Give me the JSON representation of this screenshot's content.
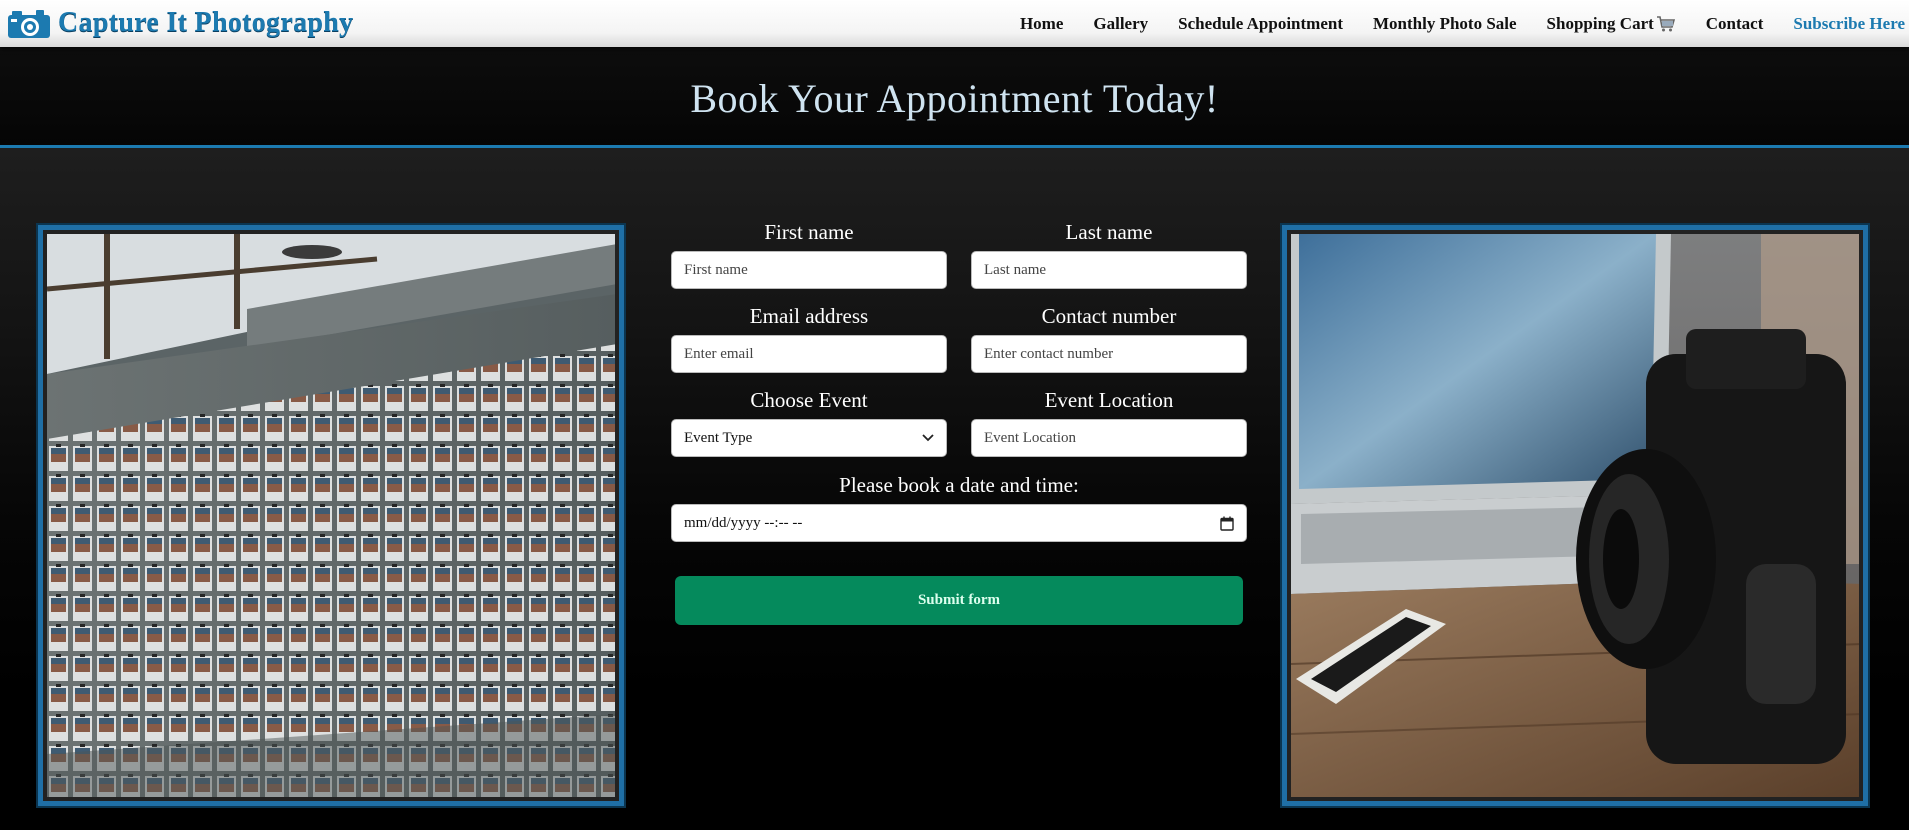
{
  "brand": {
    "name": "Capture It Photography",
    "icon": "camera-icon",
    "color": "#1c7ab0"
  },
  "nav": {
    "items": [
      {
        "label": "Home"
      },
      {
        "label": "Gallery"
      },
      {
        "label": "Schedule Appointment"
      },
      {
        "label": "Monthly Photo Sale"
      },
      {
        "label": "Shopping Cart",
        "icon": "shopping-cart-icon"
      },
      {
        "label": "Contact"
      }
    ],
    "subscribe_label": "Subscribe Here"
  },
  "hero": {
    "title": "Book Your Appointment Today!"
  },
  "form": {
    "first_name": {
      "label": "First name",
      "placeholder": "First name"
    },
    "last_name": {
      "label": "Last name",
      "placeholder": "Last name"
    },
    "email": {
      "label": "Email address",
      "placeholder": "Enter email"
    },
    "contact": {
      "label": "Contact number",
      "placeholder": "Enter contact number"
    },
    "event": {
      "label": "Choose Event",
      "selected": "Event Type"
    },
    "location": {
      "label": "Event Location",
      "placeholder": "Event Location"
    },
    "datetime": {
      "label": "Please book a date and time:",
      "placeholder": "mm/dd/yyyy --:-- --",
      "icon": "calendar-icon"
    },
    "submit_label": "Submit form"
  },
  "images": {
    "left": "photo-wall-image",
    "right": "camera-laptop-image"
  },
  "colors": {
    "accent": "#1c7ab0",
    "submit": "#058a5c",
    "background": "#000000"
  }
}
